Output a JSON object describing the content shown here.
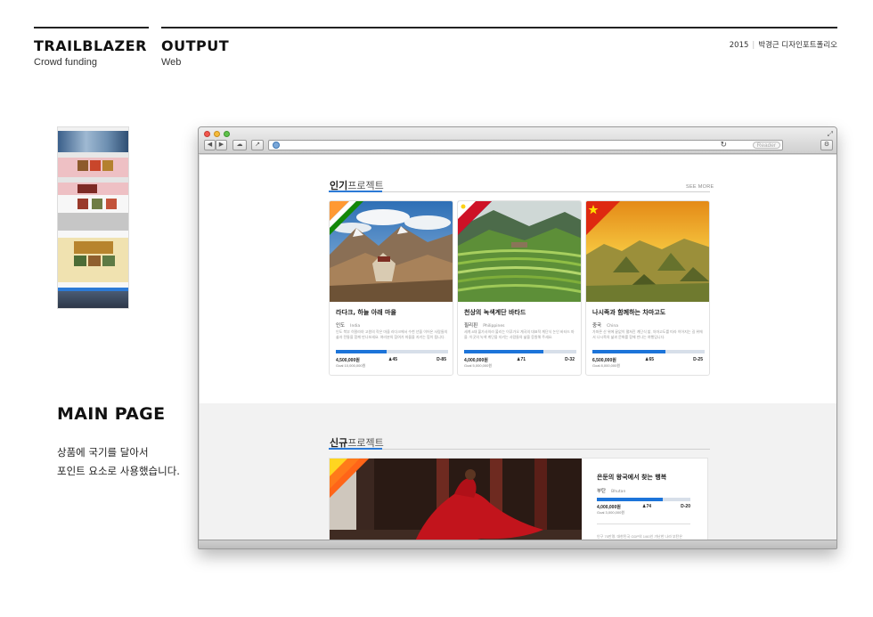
{
  "header": {
    "project_title": "TRAILBLAZER",
    "project_sub": "Crowd funding",
    "output_title": "OUTPUT",
    "output_sub": "Web",
    "year": "2015",
    "portfolio": "박경근 디자인포트폴리오"
  },
  "left": {
    "main_title": "MAIN PAGE",
    "desc_line1": "상품에 국기를 달아서",
    "desc_line2": "포인트 요소로 사용했습니다."
  },
  "browser": {
    "reader_label": "Reader",
    "reload_glyph": "↻"
  },
  "popular": {
    "title_bold": "인기",
    "title_light": "프로젝트",
    "see_more": "SEE MORE",
    "cards": [
      {
        "title": "라다크, 하늘 아래 마을",
        "country": "인도",
        "country_en": "India",
        "desc": "인도 북부 히말라야 고원의 작은 마을 라다크에서 수천 년을 이어온 사람들의 삶과 전통을 함께 만나보세요. 여러분의 참여가 마을을 지키는 힘이 됩니다.",
        "amount": "4,500,000원",
        "percent": "45",
        "dday": "D-85",
        "goal": "Goal 10,000,000원",
        "progress": 0.45,
        "flag": "india"
      },
      {
        "title": "천상의 녹색계단 바타드",
        "country": "필리핀",
        "country_en": "Philippines",
        "desc": "세계 8대 불가사의라 불리는 이푸가오 계곡의 대표적 계단식 논인 바타드 마을. 이곳의 녹색 계단을 지키는 사람들의 삶을 응원해 주세요.",
        "amount": "4,000,000원",
        "percent": "71",
        "dday": "D-32",
        "goal": "Goal 5,000,000원",
        "progress": 0.71,
        "flag": "philippines"
      },
      {
        "title": "나시족과 함께하는 차마고도",
        "country": "중국",
        "country_en": "China",
        "desc": "가파른 산 위에 끝없이 펼쳐진 계단식 밭, 차마고도를 따라 이어지는 길 위에서 나시족의 삶과 문화를 함께 만나는 여행입니다.",
        "amount": "6,500,000원",
        "percent": "65",
        "dday": "D-25",
        "goal": "Goal 8,000,000원",
        "progress": 0.65,
        "flag": "china"
      }
    ]
  },
  "newproj": {
    "title_bold": "신규",
    "title_light": "프로젝트",
    "item": {
      "title": "은둔의 왕국에서 찾는 행복",
      "country": "부탄",
      "country_en": "Bhutan",
      "amount": "4,000,000원",
      "percent": "74",
      "dday": "D-20",
      "goal": "Goal 3,000,000원",
      "progress": 0.7,
      "desc": "인구 70만명, 대한민국 GDP의 1/60인 가난한 나라 부탄은"
    }
  },
  "colors": {
    "accent": "#2c7ad6",
    "progress_fill": "#1c74d9",
    "progress_track": "#d7dfe9"
  }
}
